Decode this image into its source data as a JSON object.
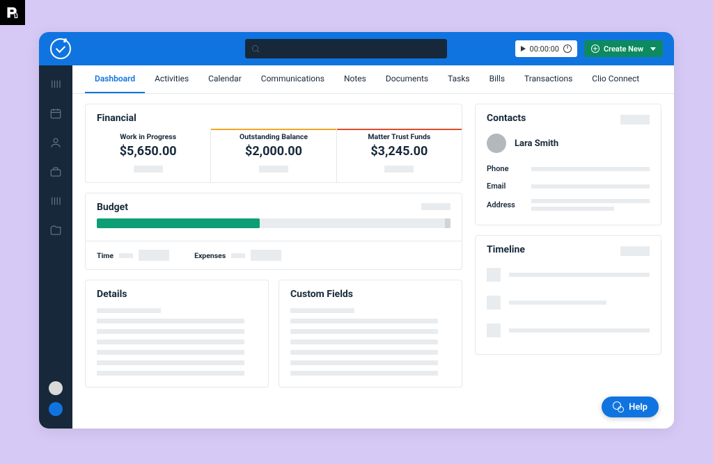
{
  "timer": {
    "value": "00:00:00"
  },
  "create_button": {
    "label": "Create New"
  },
  "tabs": [
    "Dashboard",
    "Activities",
    "Calendar",
    "Communications",
    "Notes",
    "Documents",
    "Tasks",
    "Bills",
    "Transactions",
    "Clio Connect"
  ],
  "financial": {
    "title": "Financial",
    "items": [
      {
        "label": "Work in Progress",
        "value": "$5,650.00"
      },
      {
        "label": "Outstanding Balance",
        "value": "$2,000.00"
      },
      {
        "label": "Matter Trust Funds",
        "value": "$3,245.00"
      }
    ]
  },
  "budget": {
    "title": "Budget",
    "progress_pct": 46,
    "time_label": "Time",
    "expenses_label": "Expenses"
  },
  "details": {
    "title": "Details"
  },
  "custom_fields": {
    "title": "Custom Fields"
  },
  "contacts": {
    "title": "Contacts",
    "name": "Lara Smith",
    "phone_label": "Phone",
    "email_label": "Email",
    "address_label": "Address"
  },
  "timeline": {
    "title": "Timeline"
  },
  "help": {
    "label": "Help"
  }
}
